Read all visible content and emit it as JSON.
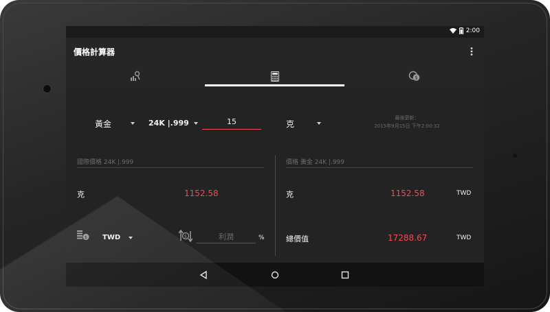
{
  "statusbar": {
    "time": "2:00"
  },
  "appbar": {
    "title": "價格計算器"
  },
  "tabs": [
    {
      "icon": "chart-search-icon",
      "selected": false
    },
    {
      "icon": "calculator-icon",
      "selected": true
    },
    {
      "icon": "currency-exchange-icon",
      "selected": false
    }
  ],
  "calculator": {
    "metal_select": "黃金",
    "purity_select": "24K |.999",
    "quantity_input": "15",
    "unit_select": "克",
    "last_update_label": "最後更新：",
    "last_update_time": "2015年9月15日 下午2:00:32"
  },
  "left_panel": {
    "header": "國際價格 24K |.999",
    "unit_label": "克",
    "price": "1152.58",
    "currency_select": "TWD",
    "profit_placeholder": "利潤",
    "percent_sign": "%"
  },
  "right_panel": {
    "header": "價格  黃金  24K |.999",
    "unit_label": "克",
    "unit_price": "1152.58",
    "unit_currency": "TWD",
    "total_label": "總價值",
    "total_price": "17288.67",
    "total_currency": "TWD"
  },
  "colors": {
    "accent": "#ef4d55",
    "background": "#232323",
    "appbar": "#262626"
  }
}
